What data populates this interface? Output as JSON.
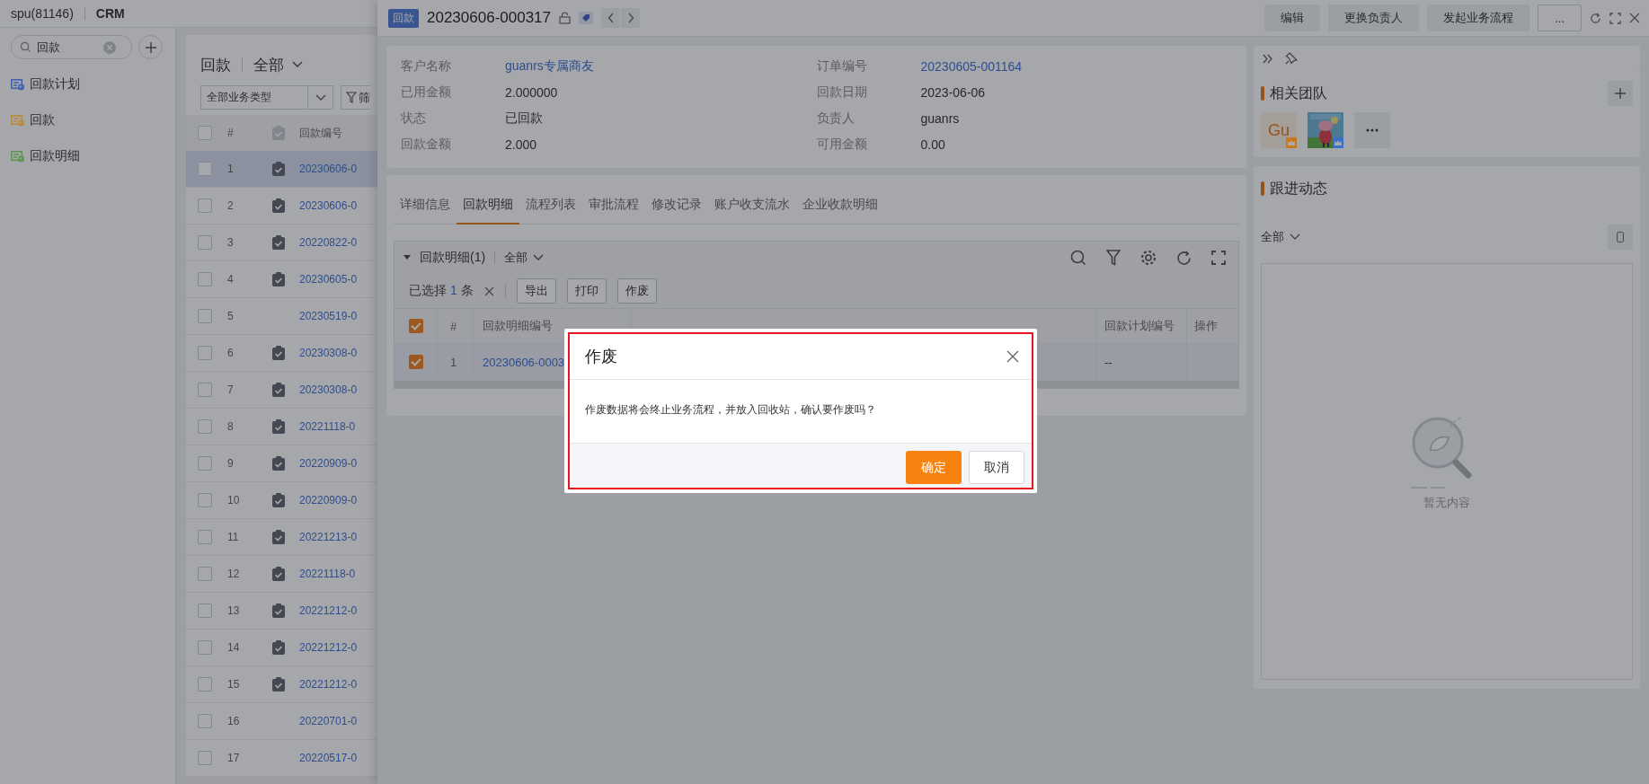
{
  "topbar": {
    "account": "spu(81146)",
    "app": "CRM"
  },
  "nav": {
    "search": {
      "value": "回款"
    },
    "items": [
      {
        "label": "回款计划",
        "color": "#4660b0"
      },
      {
        "label": "回款",
        "color": "#b88a3e"
      },
      {
        "label": "回款明细",
        "color": "#5e9450"
      }
    ]
  },
  "list": {
    "title": "回款",
    "scope": "全部",
    "type_filter": "全部业务类型",
    "filter_button": "筛",
    "header_checked": false,
    "columns": [
      "#",
      "回款编号"
    ],
    "rows": [
      {
        "index": "1",
        "clipboard": true,
        "code": "20230606-0",
        "selected": true
      },
      {
        "index": "2",
        "clipboard": true,
        "code": "20230606-0",
        "selected": false
      },
      {
        "index": "3",
        "clipboard": true,
        "code": "20220822-0",
        "selected": false
      },
      {
        "index": "4",
        "clipboard": true,
        "code": "20230605-0",
        "selected": false
      },
      {
        "index": "5",
        "clipboard": false,
        "code": "20230519-0",
        "selected": false
      },
      {
        "index": "6",
        "clipboard": true,
        "code": "20230308-0",
        "selected": false
      },
      {
        "index": "7",
        "clipboard": true,
        "code": "20230308-0",
        "selected": false
      },
      {
        "index": "8",
        "clipboard": true,
        "code": "20221118-0",
        "selected": false
      },
      {
        "index": "9",
        "clipboard": true,
        "code": "20220909-0",
        "selected": false
      },
      {
        "index": "10",
        "clipboard": true,
        "code": "20220909-0",
        "selected": false
      },
      {
        "index": "11",
        "clipboard": true,
        "code": "20221213-0",
        "selected": false
      },
      {
        "index": "12",
        "clipboard": true,
        "code": "20221118-0",
        "selected": false
      },
      {
        "index": "13",
        "clipboard": true,
        "code": "20221212-0",
        "selected": false
      },
      {
        "index": "14",
        "clipboard": true,
        "code": "20221212-0",
        "selected": false
      },
      {
        "index": "15",
        "clipboard": true,
        "code": "20221212-0",
        "selected": false
      },
      {
        "index": "16",
        "clipboard": false,
        "code": "20220701-0",
        "selected": false
      },
      {
        "index": "17",
        "clipboard": false,
        "code": "20220517-0",
        "selected": false
      }
    ]
  },
  "record": {
    "tag": "回款",
    "number": "20230606-000317",
    "actions": [
      "编辑",
      "更换负责人",
      "发起业务流程",
      "..."
    ],
    "fields": [
      {
        "label": "客户名称",
        "value": "guanrs专属商友",
        "link": true
      },
      {
        "label": "订单编号",
        "value": "20230605-001164",
        "link": true
      },
      {
        "label": "已用金额",
        "value": "2.000000",
        "link": false
      },
      {
        "label": "回款日期",
        "value": "2023-06-06",
        "link": false
      },
      {
        "label": "状态",
        "value": "已回款",
        "link": false
      },
      {
        "label": "负责人",
        "value": "guanrs",
        "link": false
      },
      {
        "label": "回款金额",
        "value": "2.000",
        "link": false
      },
      {
        "label": "可用金额",
        "value": "0.00",
        "link": false
      }
    ],
    "tabs": [
      {
        "label": "详细信息",
        "selected": false
      },
      {
        "label": "回款明细",
        "selected": true
      },
      {
        "label": "流程列表",
        "selected": false
      },
      {
        "label": "审批流程",
        "selected": false
      },
      {
        "label": "修改记录",
        "selected": false
      },
      {
        "label": "账户收支流水",
        "selected": false
      },
      {
        "label": "企业收款明细",
        "selected": false
      }
    ]
  },
  "detail_table": {
    "title": "回款明细(1)",
    "scope": "全部",
    "selected_prefix": "已选择",
    "selected_count": "1",
    "selected_unit": "条",
    "buttons": [
      "导出",
      "打印",
      "作废"
    ],
    "header_checked": true,
    "columns": [
      "#",
      "回款明细编号",
      "回款计划编号",
      "操作"
    ],
    "rows": [
      {
        "checked": true,
        "index": "1",
        "code": "20230606-0003",
        "plan": "--"
      }
    ]
  },
  "team": {
    "title": "相关团队",
    "members": [
      {
        "kind": "initials",
        "text": "Gu",
        "color": "#c9781e"
      },
      {
        "kind": "picture",
        "color": "#3a6fc9"
      }
    ]
  },
  "follow": {
    "title": "跟进动态",
    "scope": "全部",
    "empty": "暂无内容"
  },
  "dialog": {
    "title": "作废",
    "message": "作废数据将会终止业务流程，并放入回收站，确认要作废吗？",
    "confirm": "确定",
    "cancel": "取消"
  }
}
